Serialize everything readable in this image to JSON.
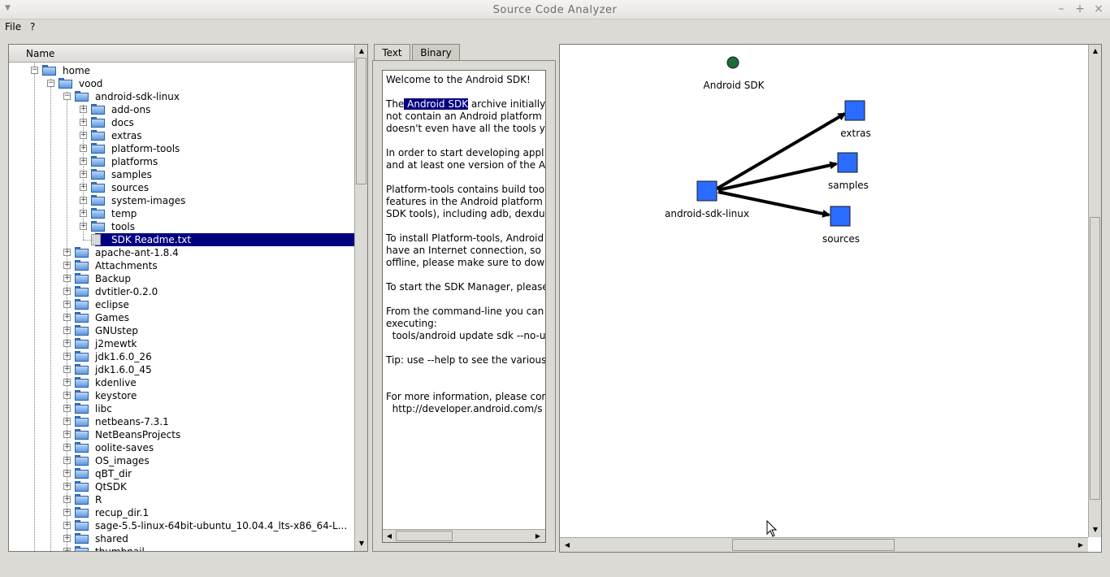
{
  "window": {
    "title": "Source Code Analyzer"
  },
  "menu": {
    "file": "File",
    "help": "?"
  },
  "tree": {
    "header": "Name",
    "rows": [
      {
        "label": "home",
        "depth": 1,
        "expander": "minus",
        "icon": "folder"
      },
      {
        "label": "vood",
        "depth": 2,
        "expander": "minus",
        "icon": "folder"
      },
      {
        "label": "android-sdk-linux",
        "depth": 3,
        "expander": "minus",
        "icon": "folder"
      },
      {
        "label": "add-ons",
        "depth": 4,
        "expander": "plus",
        "icon": "folder"
      },
      {
        "label": "docs",
        "depth": 4,
        "expander": "plus",
        "icon": "folder"
      },
      {
        "label": "extras",
        "depth": 4,
        "expander": "plus",
        "icon": "folder"
      },
      {
        "label": "platform-tools",
        "depth": 4,
        "expander": "plus",
        "icon": "folder"
      },
      {
        "label": "platforms",
        "depth": 4,
        "expander": "plus",
        "icon": "folder"
      },
      {
        "label": "samples",
        "depth": 4,
        "expander": "plus",
        "icon": "folder"
      },
      {
        "label": "sources",
        "depth": 4,
        "expander": "plus",
        "icon": "folder"
      },
      {
        "label": "system-images",
        "depth": 4,
        "expander": "plus",
        "icon": "folder"
      },
      {
        "label": "temp",
        "depth": 4,
        "expander": "plus",
        "icon": "folder"
      },
      {
        "label": "tools",
        "depth": 4,
        "expander": "plus",
        "icon": "folder"
      },
      {
        "label": "SDK Readme.txt",
        "depth": 4,
        "expander": "none",
        "icon": "file",
        "selected": true
      },
      {
        "label": "apache-ant-1.8.4",
        "depth": 3,
        "expander": "plus",
        "icon": "folder"
      },
      {
        "label": "Attachments",
        "depth": 3,
        "expander": "plus",
        "icon": "folder"
      },
      {
        "label": "Backup",
        "depth": 3,
        "expander": "plus",
        "icon": "folder"
      },
      {
        "label": "dvtitler-0.2.0",
        "depth": 3,
        "expander": "plus",
        "icon": "folder"
      },
      {
        "label": "eclipse",
        "depth": 3,
        "expander": "plus",
        "icon": "folder"
      },
      {
        "label": "Games",
        "depth": 3,
        "expander": "plus",
        "icon": "folder"
      },
      {
        "label": "GNUstep",
        "depth": 3,
        "expander": "plus",
        "icon": "folder"
      },
      {
        "label": "j2mewtk",
        "depth": 3,
        "expander": "plus",
        "icon": "folder"
      },
      {
        "label": "jdk1.6.0_26",
        "depth": 3,
        "expander": "plus",
        "icon": "folder"
      },
      {
        "label": "jdk1.6.0_45",
        "depth": 3,
        "expander": "plus",
        "icon": "folder"
      },
      {
        "label": "kdenlive",
        "depth": 3,
        "expander": "plus",
        "icon": "folder"
      },
      {
        "label": "keystore",
        "depth": 3,
        "expander": "plus",
        "icon": "folder"
      },
      {
        "label": "libc",
        "depth": 3,
        "expander": "plus",
        "icon": "folder"
      },
      {
        "label": "netbeans-7.3.1",
        "depth": 3,
        "expander": "plus",
        "icon": "folder"
      },
      {
        "label": "NetBeansProjects",
        "depth": 3,
        "expander": "plus",
        "icon": "folder"
      },
      {
        "label": "oolite-saves",
        "depth": 3,
        "expander": "plus",
        "icon": "folder"
      },
      {
        "label": "OS_images",
        "depth": 3,
        "expander": "plus",
        "icon": "folder"
      },
      {
        "label": "qBT_dir",
        "depth": 3,
        "expander": "plus",
        "icon": "folder"
      },
      {
        "label": "QtSDK",
        "depth": 3,
        "expander": "plus",
        "icon": "folder"
      },
      {
        "label": "R",
        "depth": 3,
        "expander": "plus",
        "icon": "folder"
      },
      {
        "label": "recup_dir.1",
        "depth": 3,
        "expander": "plus",
        "icon": "folder"
      },
      {
        "label": "sage-5.5-linux-64bit-ubuntu_10.04.4_lts-x86_64-L...",
        "depth": 3,
        "expander": "plus",
        "icon": "folder"
      },
      {
        "label": "shared",
        "depth": 3,
        "expander": "plus",
        "icon": "folder"
      },
      {
        "label": "thumbnail",
        "depth": 3,
        "expander": "plus",
        "icon": "folder"
      }
    ]
  },
  "tabs": {
    "text": "Text",
    "binary": "Binary"
  },
  "textview": {
    "before_highlight": "The",
    "highlight": " Android SDK",
    "lines": [
      "Welcome to the Android SDK!",
      "",
      "__HL__ archive initially",
      "not contain an Android platform",
      "doesn't even have all the tools yo",
      "",
      "In order to start developing appl",
      "and at least one version of the A",
      "",
      "Platform-tools contains build tool",
      "features in the Android platform",
      "SDK tools), including adb, dexdu",
      "",
      "To install Platform-tools, Android",
      "have an Internet connection, so",
      "offline, please make sure to dow",
      "",
      "To start the SDK Manager, please",
      "",
      "From the command-line you can",
      "executing:",
      "  tools/android update sdk --no-u",
      "",
      "Tip: use --help to see the various",
      "",
      "",
      "For more information, please cor",
      "  http://developer.android.com/s"
    ]
  },
  "graph": {
    "nodes": [
      {
        "id": "android-sdk",
        "label": "Android SDK",
        "shape": "circle",
        "color": "#1f6b3a"
      },
      {
        "id": "android-sdk-linux",
        "label": "android-sdk-linux",
        "shape": "square",
        "color": "#2a6cff"
      },
      {
        "id": "extras",
        "label": "extras",
        "shape": "square",
        "color": "#2a6cff"
      },
      {
        "id": "samples",
        "label": "samples",
        "shape": "square",
        "color": "#2a6cff"
      },
      {
        "id": "sources",
        "label": "sources",
        "shape": "square",
        "color": "#2a6cff"
      }
    ],
    "edges": [
      {
        "from": "android-sdk-linux",
        "to": "extras"
      },
      {
        "from": "android-sdk-linux",
        "to": "samples"
      },
      {
        "from": "android-sdk-linux",
        "to": "sources"
      }
    ]
  },
  "colors": {
    "selection": "#00007f",
    "node_blue": "#2a6cff",
    "root_green": "#1f6b3a"
  }
}
